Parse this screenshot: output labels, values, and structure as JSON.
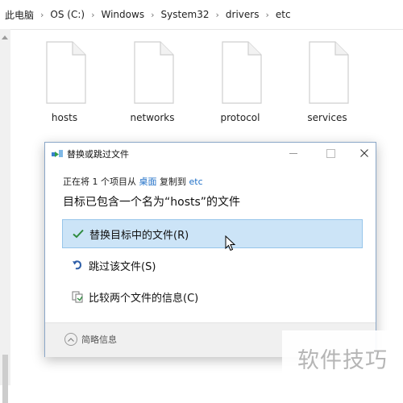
{
  "breadcrumb": [
    "此电脑",
    "OS (C:)",
    "Windows",
    "System32",
    "drivers",
    "etc"
  ],
  "files": [
    {
      "name": "hosts"
    },
    {
      "name": "networks"
    },
    {
      "name": "protocol"
    },
    {
      "name": "services"
    }
  ],
  "dialog": {
    "title": "替换或跳过文件",
    "info": {
      "prefix": "正在将 1 个项目从",
      "source": "桌面",
      "middle": "复制到",
      "dest": "etc"
    },
    "headline": "目标已包含一个名为“hosts”的文件",
    "options": {
      "replace": "替换目标中的文件(R)",
      "skip": "跳过该文件(S)",
      "compare": "比较两个文件的信息(C)"
    },
    "details_label": "简略信息"
  },
  "watermark": "软件技巧",
  "colors": {
    "accent": "#1f6fc7",
    "hover_bg": "#cce4f7",
    "check_green": "#2e8b3e"
  },
  "icons": {
    "replace": "check-icon",
    "skip": "skip-arrow-icon",
    "compare": "compare-files-icon",
    "details": "chevron-up-icon"
  }
}
